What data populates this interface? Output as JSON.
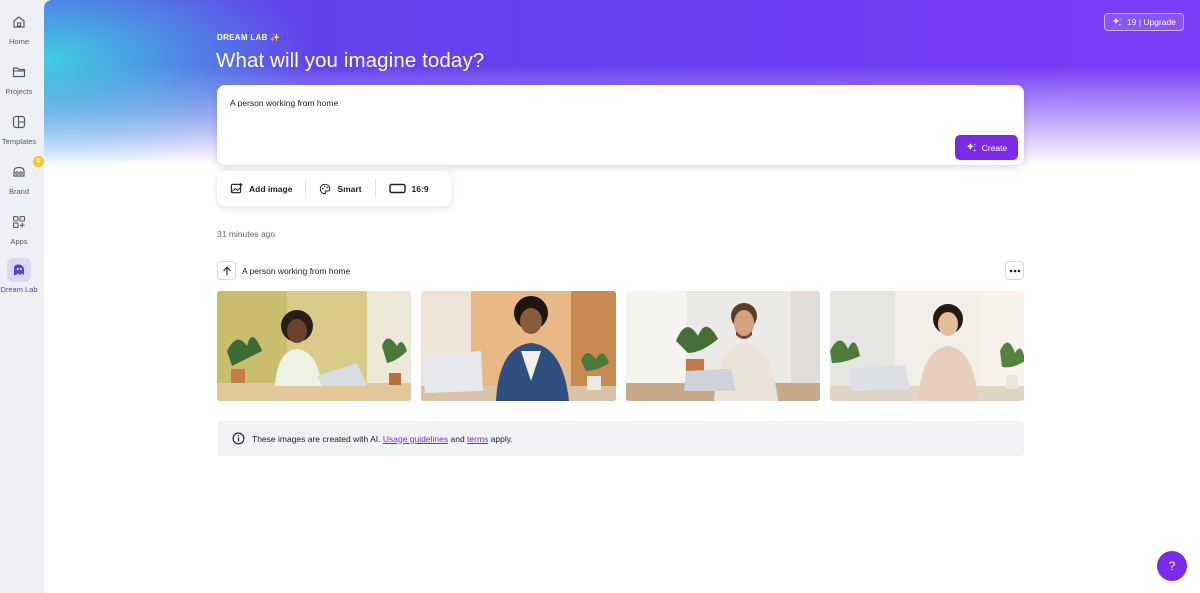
{
  "sidebar": {
    "items": [
      {
        "label": "Home",
        "icon": "home-icon"
      },
      {
        "label": "Projects",
        "icon": "folder-icon"
      },
      {
        "label": "Templates",
        "icon": "templates-icon"
      },
      {
        "label": "Brand",
        "icon": "brand-icon",
        "badge": "crown"
      },
      {
        "label": "Apps",
        "icon": "apps-icon"
      },
      {
        "label": "Dream Lab",
        "icon": "dream-lab-icon",
        "active": true
      }
    ]
  },
  "header": {
    "upgrade_label": "19 | Upgrade",
    "eyebrow": "DREAM LAB ✨",
    "title": "What will you imagine today?"
  },
  "prompt": {
    "value": "A person working from home",
    "create_label": "Create"
  },
  "options": {
    "add_image": "Add image",
    "style": "Smart",
    "aspect": "16:9"
  },
  "history": {
    "timestamp": "31 minutes ago",
    "prompt": "A person working from home",
    "images": [
      {
        "alt": "Woman with curly hair smiling at laptop among plants"
      },
      {
        "alt": "Smiling woman in blue cardigan typing on laptop"
      },
      {
        "alt": "Bearded man typing on laptop near window"
      },
      {
        "alt": "Woman in beige sweater working on laptop"
      }
    ]
  },
  "notice": {
    "text_before": "These images are created with AI.",
    "link1": "Usage guidelines",
    "middle": "and",
    "link2": "terms",
    "after": "apply."
  },
  "help_label": "?",
  "colors": {
    "accent": "#7d2ae8",
    "hero_start": "#3fd6e2",
    "hero_mid": "#6a3ff0"
  }
}
